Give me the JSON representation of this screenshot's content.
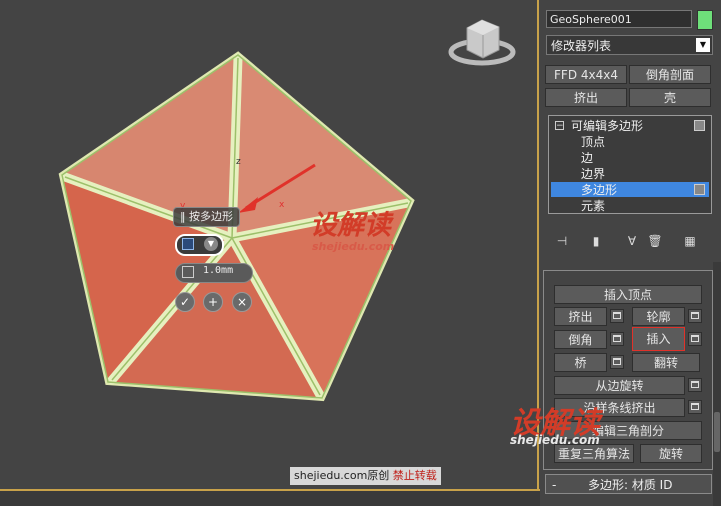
{
  "viewport": {
    "caddy": {
      "title": "按多边形",
      "amount": "1.0mm",
      "ok_glyph": "✓",
      "apply_glyph": "+",
      "cancel_glyph": "×"
    },
    "watermark_text": "设解读",
    "watermark_url": "shejiedu.com",
    "viewcube_face": "左 前",
    "axis_labels": {
      "y": "y",
      "x": "x",
      "z": "z"
    },
    "bottom_banner": {
      "site": "shejiedu.com",
      "original": "原创",
      "forbid": "禁止转载"
    }
  },
  "panel": {
    "object_name": "GeoSphere001",
    "object_color": "#6ee07a",
    "modifier_list": "修改器列表",
    "row1": [
      "FFD 4x4x4",
      "倒角剖面"
    ],
    "row2": [
      "挤出",
      "壳"
    ],
    "stack": {
      "root": "可编辑多边形",
      "children": [
        "顶点",
        "边",
        "边界",
        "多边形",
        "元素"
      ],
      "selected": "多边形"
    },
    "edit_polygons": {
      "insert_vertex": "插入顶点",
      "extrude": "挤出",
      "outline": "轮廓",
      "bevel": "倒角",
      "inset": "插入",
      "bridge": "桥",
      "flip": "翻转",
      "hinge": "从边旋转",
      "extrude_spline": "沿样条线挤出",
      "edit_tri": "编辑三角剖分",
      "retriangulate": "重复三角算法",
      "turn": "旋转"
    },
    "material_rollout": "多边形: 材质 ID",
    "rollout_toggle": "-",
    "colors": {
      "highlight": "#3f87e0",
      "inset_border": "#e0322a"
    }
  }
}
